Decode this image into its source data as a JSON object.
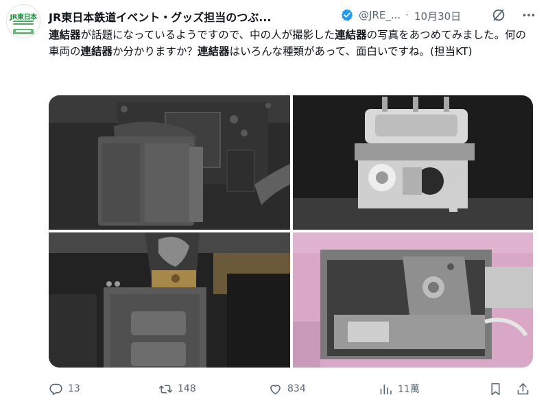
{
  "avatar": {
    "logo_text": "JR東日本"
  },
  "header": {
    "display_name": "JR東日本鉄道イベント・グッズ担当のつぶ...",
    "handle": "@JRE_...",
    "separator": "·",
    "date": "10月30日"
  },
  "tweet": {
    "segments": [
      {
        "text": "連結器",
        "bold": true
      },
      {
        "text": "が話題になっているようですので、中の人が撮影した",
        "bold": false
      },
      {
        "text": "連結器",
        "bold": true
      },
      {
        "text": "の写真をあつめてみました。何の車両の",
        "bold": false
      },
      {
        "text": "連結器",
        "bold": true
      },
      {
        "text": "か分かりますか？",
        "bold": false
      },
      {
        "text": "連結器",
        "bold": true
      },
      {
        "text": "はいろんな種類があって、面白いですね。(担当KT)",
        "bold": false
      }
    ]
  },
  "media": {
    "photos": [
      {
        "subject": "black-coupler"
      },
      {
        "subject": "white-electric-coupler"
      },
      {
        "subject": "grey-coupler-brass-plate"
      },
      {
        "subject": "pink-car-coupler"
      }
    ]
  },
  "actions": {
    "reply_count": "13",
    "retweet_count": "148",
    "like_count": "834",
    "view_count": "11萬"
  },
  "colors": {
    "text": "#0f1419",
    "secondary": "#536471",
    "verified": "#1d9bf0",
    "brand_green": "#1e8c3e"
  }
}
